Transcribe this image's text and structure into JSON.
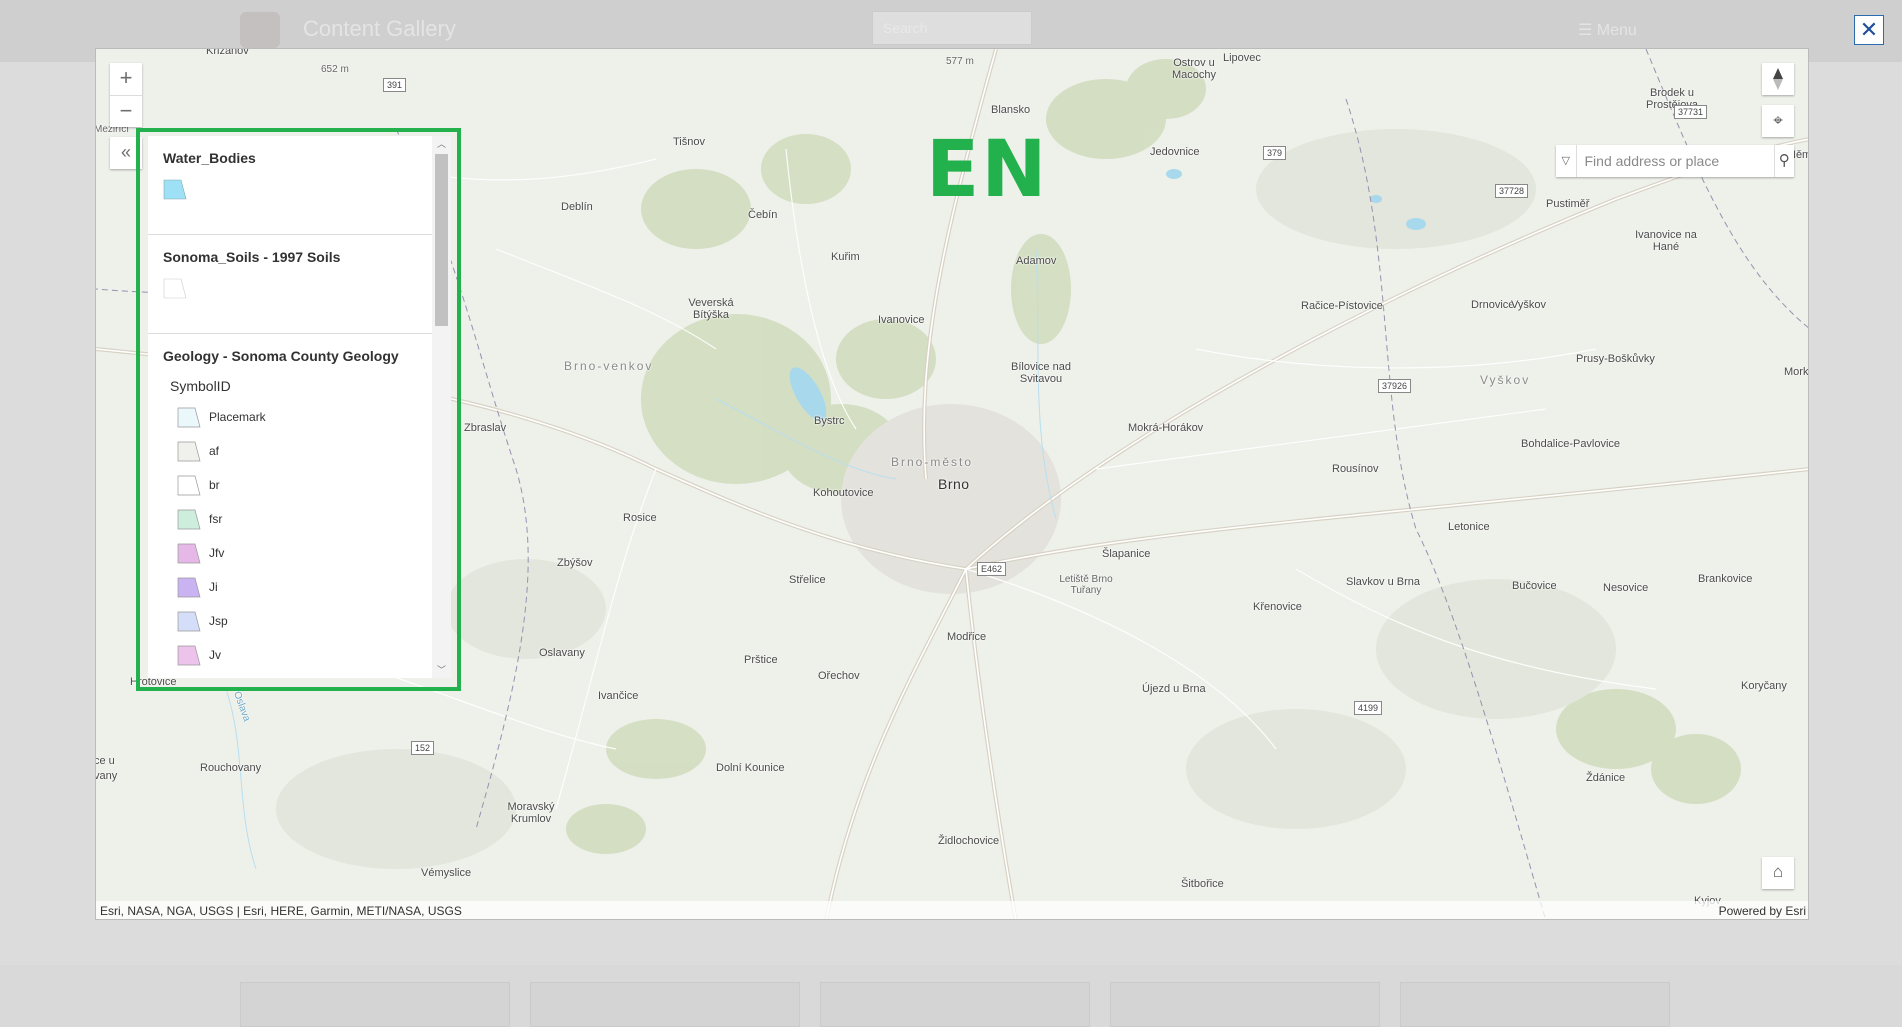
{
  "background": {
    "app_title": "Content Gallery",
    "search_placeholder": "Search",
    "menu_label": "Menu"
  },
  "modal": {
    "close_glyph": "✕"
  },
  "map": {
    "overlay_label": "EN",
    "search": {
      "placeholder": "Find address or place"
    },
    "attribution": "Esri, NASA, NGA, USGS | Esri, HERE, Garmin, METI/NASA, USGS",
    "powered_by": "Powered by Esri",
    "places": [
      {
        "name": "Křižanov",
        "cls": "small"
      },
      {
        "name": "652 m",
        "cls": "small"
      },
      {
        "name": "577 m",
        "cls": "small"
      },
      {
        "name": "Ostrov u Macochy",
        "cls": ""
      },
      {
        "name": "Lipovec",
        "cls": ""
      },
      {
        "name": "Brodek u Prostějova",
        "cls": ""
      },
      {
        "name": "Tišnov",
        "cls": ""
      },
      {
        "name": "Blansko",
        "cls": ""
      },
      {
        "name": "Jedovnice",
        "cls": ""
      },
      {
        "name": "Deblín",
        "cls": ""
      },
      {
        "name": "Čebín",
        "cls": ""
      },
      {
        "name": "Pustiměř",
        "cls": ""
      },
      {
        "name": "Kuřim",
        "cls": ""
      },
      {
        "name": "Adamov",
        "cls": ""
      },
      {
        "name": "Ivanovice na Hané",
        "cls": ""
      },
      {
        "name": "Veverská Bítýška",
        "cls": ""
      },
      {
        "name": "Ivanovice",
        "cls": ""
      },
      {
        "name": "Račice-Pístovice",
        "cls": ""
      },
      {
        "name": "Drnovice",
        "cls": ""
      },
      {
        "name": "Vyškov",
        "cls": ""
      },
      {
        "name": "Brno-venkov",
        "cls": "region"
      },
      {
        "name": "Prusy-Boškůvky",
        "cls": ""
      },
      {
        "name": "Bílovice nad Svitavou",
        "cls": ""
      },
      {
        "name": "Vyškov",
        "cls": "region"
      },
      {
        "name": "Bystrc",
        "cls": ""
      },
      {
        "name": "Zbraslav",
        "cls": ""
      },
      {
        "name": "Mokrá-Horákov",
        "cls": ""
      },
      {
        "name": "Bohdalice-Pavlovice",
        "cls": ""
      },
      {
        "name": "Brno-město",
        "cls": "region"
      },
      {
        "name": "Brno",
        "cls": "big"
      },
      {
        "name": "Rousínov",
        "cls": ""
      },
      {
        "name": "Kohoutovice",
        "cls": ""
      },
      {
        "name": "Rosice",
        "cls": ""
      },
      {
        "name": "Letonice",
        "cls": ""
      },
      {
        "name": "Šlapanice",
        "cls": ""
      },
      {
        "name": "Zbýšov",
        "cls": ""
      },
      {
        "name": "Střelice",
        "cls": ""
      },
      {
        "name": "Letiště Brno Tuřany",
        "cls": "small"
      },
      {
        "name": "Slavkov u Brna",
        "cls": ""
      },
      {
        "name": "Bučovice",
        "cls": ""
      },
      {
        "name": "Nesovice",
        "cls": ""
      },
      {
        "name": "Brankovice",
        "cls": ""
      },
      {
        "name": "Křenovice",
        "cls": ""
      },
      {
        "name": "Modřice",
        "cls": ""
      },
      {
        "name": "Oslavany",
        "cls": ""
      },
      {
        "name": "Prštice",
        "cls": ""
      },
      {
        "name": "Ořechov",
        "cls": ""
      },
      {
        "name": "Újezd u Brna",
        "cls": ""
      },
      {
        "name": "Koryčany",
        "cls": ""
      },
      {
        "name": "Ivančice",
        "cls": ""
      },
      {
        "name": "Hrotovice",
        "cls": ""
      },
      {
        "name": "Rouchovany",
        "cls": ""
      },
      {
        "name": "Dolní Kounice",
        "cls": ""
      },
      {
        "name": "Ždánice",
        "cls": ""
      },
      {
        "name": "Moravský Krumlov",
        "cls": ""
      },
      {
        "name": "Židlochovice",
        "cls": ""
      },
      {
        "name": "Vémyslice",
        "cls": ""
      },
      {
        "name": "Šitbořice",
        "cls": ""
      },
      {
        "name": "Kyjov",
        "cls": ""
      },
      {
        "name": "Meziříčí",
        "cls": "small"
      },
      {
        "name": "Něm",
        "cls": ""
      },
      {
        "name": "Mork",
        "cls": ""
      },
      {
        "name": "ce u",
        "cls": ""
      },
      {
        "name": "vany",
        "cls": ""
      },
      {
        "name": "Oslava",
        "cls": "small"
      }
    ],
    "shields": [
      "391",
      "577",
      "379",
      "37731",
      "37728",
      "37926",
      "E462",
      "152",
      "4199"
    ]
  },
  "legend": {
    "layers": [
      {
        "title": "Water_Bodies",
        "items": [
          {
            "label": "",
            "color": "#9ee0f5"
          }
        ]
      },
      {
        "title": "Sonoma_Soils - 1997 Soils",
        "items": [
          {
            "label": "",
            "color": "#ffffff"
          }
        ]
      },
      {
        "title": "Geology - Sonoma County Geology",
        "field": "SymbolID",
        "items": [
          {
            "label": "Placemark",
            "color": "#eaf7fb"
          },
          {
            "label": "af",
            "color": "#f0f0ec"
          },
          {
            "label": "br",
            "color": "#ffffff"
          },
          {
            "label": "fsr",
            "color": "#cdeedd"
          },
          {
            "label": "Jfv",
            "color": "#e6b8e8"
          },
          {
            "label": "Ji",
            "color": "#c9b3f2"
          },
          {
            "label": "Jsp",
            "color": "#d5def8"
          },
          {
            "label": "Jv",
            "color": "#edc3ec"
          }
        ]
      }
    ]
  }
}
